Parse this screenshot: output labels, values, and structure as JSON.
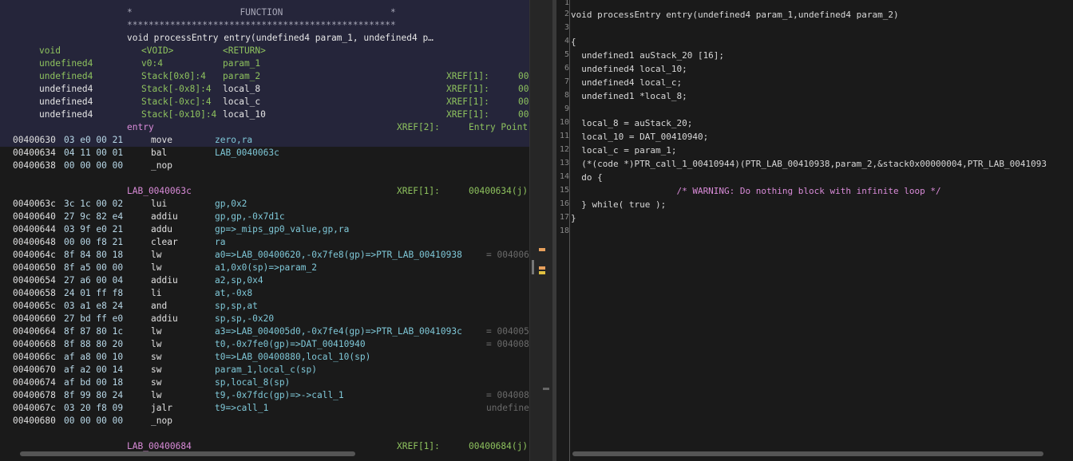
{
  "listing": {
    "header_lines": [
      "*                    FUNCTION                    *",
      "**************************************************"
    ],
    "signature": "void processEntry entry(undefined4 param_1, undefined4 p…",
    "params": [
      {
        "type": "void",
        "loc": "<VOID>",
        "name": "<RETURN>",
        "xref": "",
        "xaddr": ""
      },
      {
        "type": "undefined4",
        "loc": "v0:4",
        "name": "param_1",
        "xref": "",
        "xaddr": ""
      },
      {
        "type": "undefined4",
        "loc": "Stack[0x0]:4",
        "name": "param_2",
        "xref": "XREF[1]:",
        "xaddr": "00"
      },
      {
        "type": "undefined4",
        "loc": "Stack[-0x8]:4",
        "name": "local_8",
        "xref": "XREF[1]:",
        "xaddr": "00"
      },
      {
        "type": "undefined4",
        "loc": "Stack[-0xc]:4",
        "name": "local_c",
        "xref": "XREF[1]:",
        "xaddr": "00"
      },
      {
        "type": "undefined4",
        "loc": "Stack[-0x10]:4",
        "name": "local_10",
        "xref": "XREF[1]:",
        "xaddr": "00"
      }
    ],
    "entry_label": "entry",
    "entry_xref": "XREF[2]:",
    "entry_xref_target": "Entry Point",
    "block1": [
      {
        "addr": "00400630",
        "bytes": "03 e0 00 21",
        "mnem": "move",
        "ops": "zero,ra",
        "extra": ""
      },
      {
        "addr": "00400634",
        "bytes": "04 11 00 01",
        "mnem": "bal",
        "ops": "LAB_0040063c",
        "extra": ""
      },
      {
        "addr": "00400638",
        "bytes": "00 00 00 00",
        "mnem": "_nop",
        "ops": "",
        "extra": ""
      }
    ],
    "label2": "LAB_0040063c",
    "label2_xref": "XREF[1]:",
    "label2_xref_target": "00400634(j)",
    "block2": [
      {
        "addr": "0040063c",
        "bytes": "3c 1c 00 02",
        "mnem": "lui",
        "ops": "gp,0x2",
        "extra": ""
      },
      {
        "addr": "00400640",
        "bytes": "27 9c 82 e4",
        "mnem": "addiu",
        "ops": "gp,gp,-0x7d1c",
        "extra": ""
      },
      {
        "addr": "00400644",
        "bytes": "03 9f e0 21",
        "mnem": "addu",
        "ops": "gp=>_mips_gp0_value,gp,ra",
        "extra": ""
      },
      {
        "addr": "00400648",
        "bytes": "00 00 f8 21",
        "mnem": "clear",
        "ops": "ra",
        "extra": ""
      },
      {
        "addr": "0040064c",
        "bytes": "8f 84 80 18",
        "mnem": "lw",
        "ops": "a0=>LAB_00400620,-0x7fe8(gp)=>PTR_LAB_00410938",
        "extra": "= 004006"
      },
      {
        "addr": "00400650",
        "bytes": "8f a5 00 00",
        "mnem": "lw",
        "ops": "a1,0x0(sp)=>param_2",
        "extra": ""
      },
      {
        "addr": "00400654",
        "bytes": "27 a6 00 04",
        "mnem": "addiu",
        "ops": "a2,sp,0x4",
        "extra": ""
      },
      {
        "addr": "00400658",
        "bytes": "24 01 ff f8",
        "mnem": "li",
        "ops": "at,-0x8",
        "extra": ""
      },
      {
        "addr": "0040065c",
        "bytes": "03 a1 e8 24",
        "mnem": "and",
        "ops": "sp,sp,at",
        "extra": ""
      },
      {
        "addr": "00400660",
        "bytes": "27 bd ff e0",
        "mnem": "addiu",
        "ops": "sp,sp,-0x20",
        "extra": ""
      },
      {
        "addr": "00400664",
        "bytes": "8f 87 80 1c",
        "mnem": "lw",
        "ops": "a3=>LAB_004005d0,-0x7fe4(gp)=>PTR_LAB_0041093c",
        "extra": "= 004005"
      },
      {
        "addr": "00400668",
        "bytes": "8f 88 80 20",
        "mnem": "lw",
        "ops": "t0,-0x7fe0(gp)=>DAT_00410940",
        "extra": "= 004008"
      },
      {
        "addr": "0040066c",
        "bytes": "af a8 00 10",
        "mnem": "sw",
        "ops": "t0=>LAB_00400880,local_10(sp)",
        "extra": ""
      },
      {
        "addr": "00400670",
        "bytes": "af a2 00 14",
        "mnem": "sw",
        "ops": "param_1,local_c(sp)",
        "extra": ""
      },
      {
        "addr": "00400674",
        "bytes": "af bd 00 18",
        "mnem": "sw",
        "ops": "sp,local_8(sp)",
        "extra": ""
      },
      {
        "addr": "00400678",
        "bytes": "8f 99 80 24",
        "mnem": "lw",
        "ops": "t9,-0x7fdc(gp)=>->call_1",
        "extra": "= 004008"
      },
      {
        "addr": "0040067c",
        "bytes": "03 20 f8 09",
        "mnem": "jalr",
        "ops": "t9=>call_1",
        "extra": "undefine"
      },
      {
        "addr": "00400680",
        "bytes": "00 00 00 00",
        "mnem": "_nop",
        "ops": "",
        "extra": ""
      }
    ],
    "label3": "LAB_00400684",
    "label3_xref": "XREF[1]:",
    "label3_xref_target": "00400684(j)"
  },
  "decompiler": {
    "line_numbers": [
      "1",
      "2",
      "3",
      "4",
      "5",
      "6",
      "7",
      "8",
      "9",
      "10",
      "11",
      "12",
      "13",
      "14",
      "15",
      "16",
      "17",
      "18"
    ],
    "lines": [
      "",
      "void processEntry entry(undefined4 param_1,undefined4 param_2)",
      "",
      "{",
      "  undefined1 auStack_20 [16];",
      "  undefined4 local_10;",
      "  undefined4 local_c;",
      "  undefined1 *local_8;",
      "",
      "  local_8 = auStack_20;",
      "  local_10 = DAT_00410940;",
      "  local_c = param_1;",
      "  (*(code *)PTR_call_1_00410944)(PTR_LAB_00410938,param_2,&stack0x00000004,PTR_LAB_0041093",
      "  do {",
      "                    /* WARNING: Do nothing block with infinite loop */",
      "  } while( true );",
      "}",
      ""
    ]
  },
  "colors": {
    "accent": "#8ec25e",
    "header_bg": "#25253a",
    "highlight": "#5a5a40"
  }
}
